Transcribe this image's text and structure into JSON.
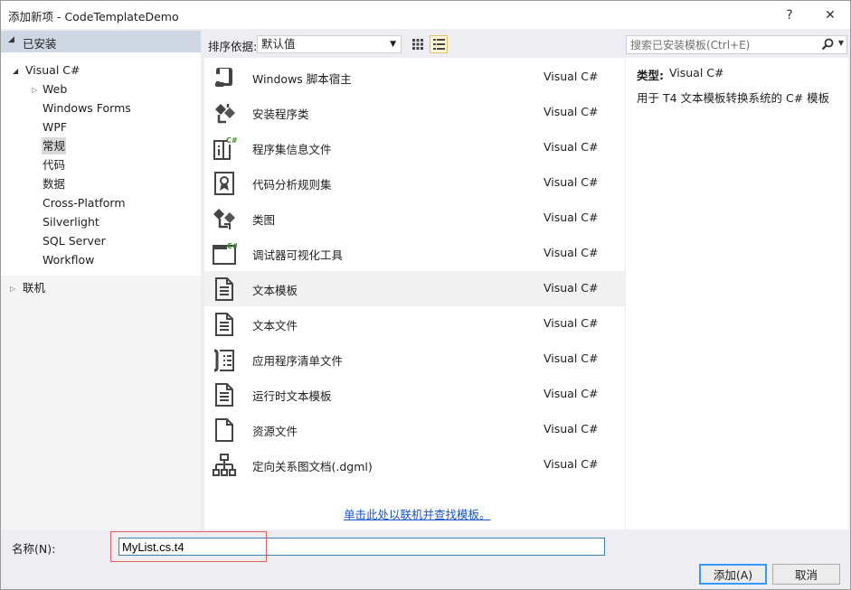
{
  "window": {
    "title": "添加新项 - CodeTemplateDemo",
    "help_glyph": "?",
    "close_glyph": "✕"
  },
  "tree": {
    "installed_header": "已安装",
    "root": "Visual C#",
    "items": [
      {
        "label": "Web",
        "expandable": true
      },
      {
        "label": "Windows Forms"
      },
      {
        "label": "WPF"
      },
      {
        "label": "常规",
        "selected": true
      },
      {
        "label": "代码"
      },
      {
        "label": "数据"
      },
      {
        "label": "Cross-Platform"
      },
      {
        "label": "Silverlight"
      },
      {
        "label": "SQL Server"
      },
      {
        "label": "Workflow"
      }
    ],
    "online": "联机"
  },
  "toolbar": {
    "sort_label": "排序依据:",
    "sort_value": "默认值"
  },
  "templates": [
    {
      "name": "Windows 脚本宿主",
      "lang": "Visual C#",
      "icon": "script-host-icon"
    },
    {
      "name": "安装程序类",
      "lang": "Visual C#",
      "icon": "installer-class-icon"
    },
    {
      "name": "程序集信息文件",
      "lang": "Visual C#",
      "icon": "assembly-info-icon"
    },
    {
      "name": "代码分析规则集",
      "lang": "Visual C#",
      "icon": "rule-set-icon"
    },
    {
      "name": "类图",
      "lang": "Visual C#",
      "icon": "class-diagram-icon"
    },
    {
      "name": "调试器可视化工具",
      "lang": "Visual C#",
      "icon": "debugger-visualizer-icon"
    },
    {
      "name": "文本模板",
      "lang": "Visual C#",
      "icon": "text-template-icon",
      "selected": true
    },
    {
      "name": "文本文件",
      "lang": "Visual C#",
      "icon": "text-file-icon"
    },
    {
      "name": "应用程序清单文件",
      "lang": "Visual C#",
      "icon": "manifest-file-icon"
    },
    {
      "name": "运行时文本模板",
      "lang": "Visual C#",
      "icon": "runtime-template-icon"
    },
    {
      "name": "资源文件",
      "lang": "Visual C#",
      "icon": "resource-file-icon"
    },
    {
      "name": "定向关系图文档(.dgml)",
      "lang": "Visual C#",
      "icon": "dgml-icon"
    }
  ],
  "online_link": "单击此处以联机并查找模板。",
  "search": {
    "placeholder": "搜索已安装模板(Ctrl+E)"
  },
  "details": {
    "type_label": "类型:",
    "type_value": "Visual C#",
    "description": "用于 T4 文本模板转换系统的 C# 模板"
  },
  "name_field": {
    "label": "名称(N):",
    "value": "MyList.cs.t4"
  },
  "buttons": {
    "add": "添加(A)",
    "cancel": "取消"
  },
  "colors": {
    "accent": "#3399ff",
    "link": "#1a55c8",
    "highlight": "#e06060",
    "selected_row": "#f1f1f1"
  }
}
